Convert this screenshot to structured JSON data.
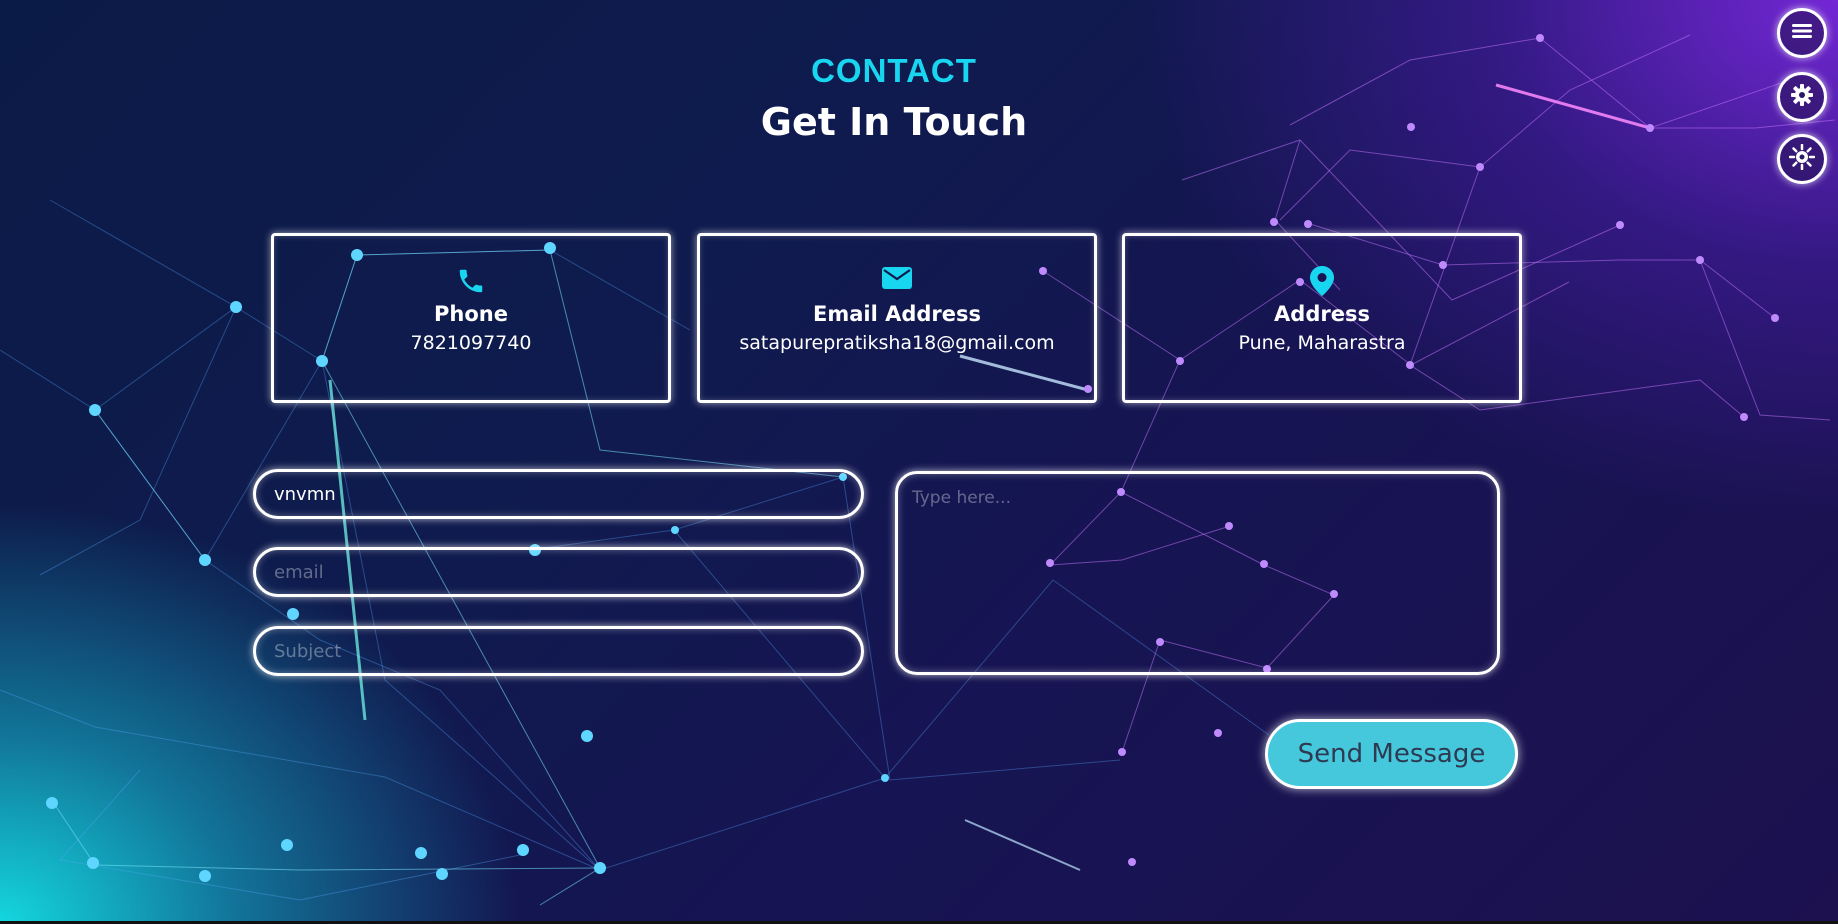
{
  "header": {
    "eyebrow": "CONTACT",
    "title": "Get In Touch"
  },
  "cards": [
    {
      "icon": "phone-icon",
      "title": "Phone",
      "value": "7821097740"
    },
    {
      "icon": "envelope-icon",
      "title": "Email Address",
      "value": "satapurepratiksha18@gmail.com"
    },
    {
      "icon": "map-pin-icon",
      "title": "Address",
      "value": "Pune, Maharastra"
    }
  ],
  "form": {
    "name": {
      "value": "vnvmn",
      "placeholder": ""
    },
    "email": {
      "value": "",
      "placeholder": "email"
    },
    "subject": {
      "value": "",
      "placeholder": "Subject"
    },
    "message": {
      "value": "",
      "placeholder": "Type here..."
    },
    "submit_label": "Send Message"
  },
  "side_buttons": [
    {
      "icon": "menu-icon"
    },
    {
      "icon": "gear-icon"
    },
    {
      "icon": "sun-icon"
    }
  ],
  "colors": {
    "accent": "#18d6f0",
    "button_bg": "#45c8dc",
    "bg_dark": "#0f1b4e",
    "bg_purple": "#7a28dc",
    "bg_cyan": "#14e1e6"
  }
}
